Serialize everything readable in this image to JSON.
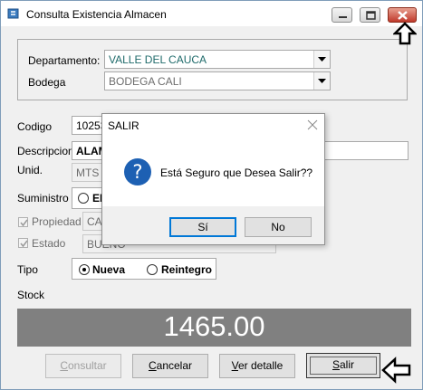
{
  "window": {
    "title": "Consulta Existencia Almacen"
  },
  "ubicacion": {
    "departamento_label": "Departamento:",
    "departamento_value": "VALLE DEL CAUCA",
    "bodega_label": "Bodega",
    "bodega_value": "BODEGA CALI"
  },
  "form": {
    "codigo_label": "Codigo",
    "codigo_value": "10253",
    "descripcion_label": "Descripcion",
    "descripcion_value": "ALAM",
    "unidad_label": "Unid.",
    "unidad_value": "MTS",
    "suministro_label": "Suministro",
    "suministro_option": "EE",
    "propiedad_label": "Propiedad",
    "propiedad_value": "CAF",
    "estado_label": "Estado",
    "estado_value": "BUENO",
    "tipo_label": "Tipo",
    "tipo_options": [
      "Nueva",
      "Reintegro"
    ],
    "tipo_selected": "Nueva",
    "stock_label": "Stock",
    "stock_value": "1465.00"
  },
  "buttons": {
    "consultar": {
      "first": "C",
      "rest": "onsultar"
    },
    "cancelar": {
      "first": "C",
      "rest": "ancelar"
    },
    "ver_detalle": {
      "first": "V",
      "rest": "er detalle"
    },
    "salir": {
      "first": "S",
      "rest": "alir"
    }
  },
  "dialog": {
    "title": "SALIR",
    "message": "Está Seguro que Desea Salir??",
    "yes_label": "Sí",
    "no_label": "No"
  },
  "colors": {
    "stock_bar": "#808080",
    "dialog_icon": "#1d60b3",
    "focus_border": "#0078d7"
  }
}
